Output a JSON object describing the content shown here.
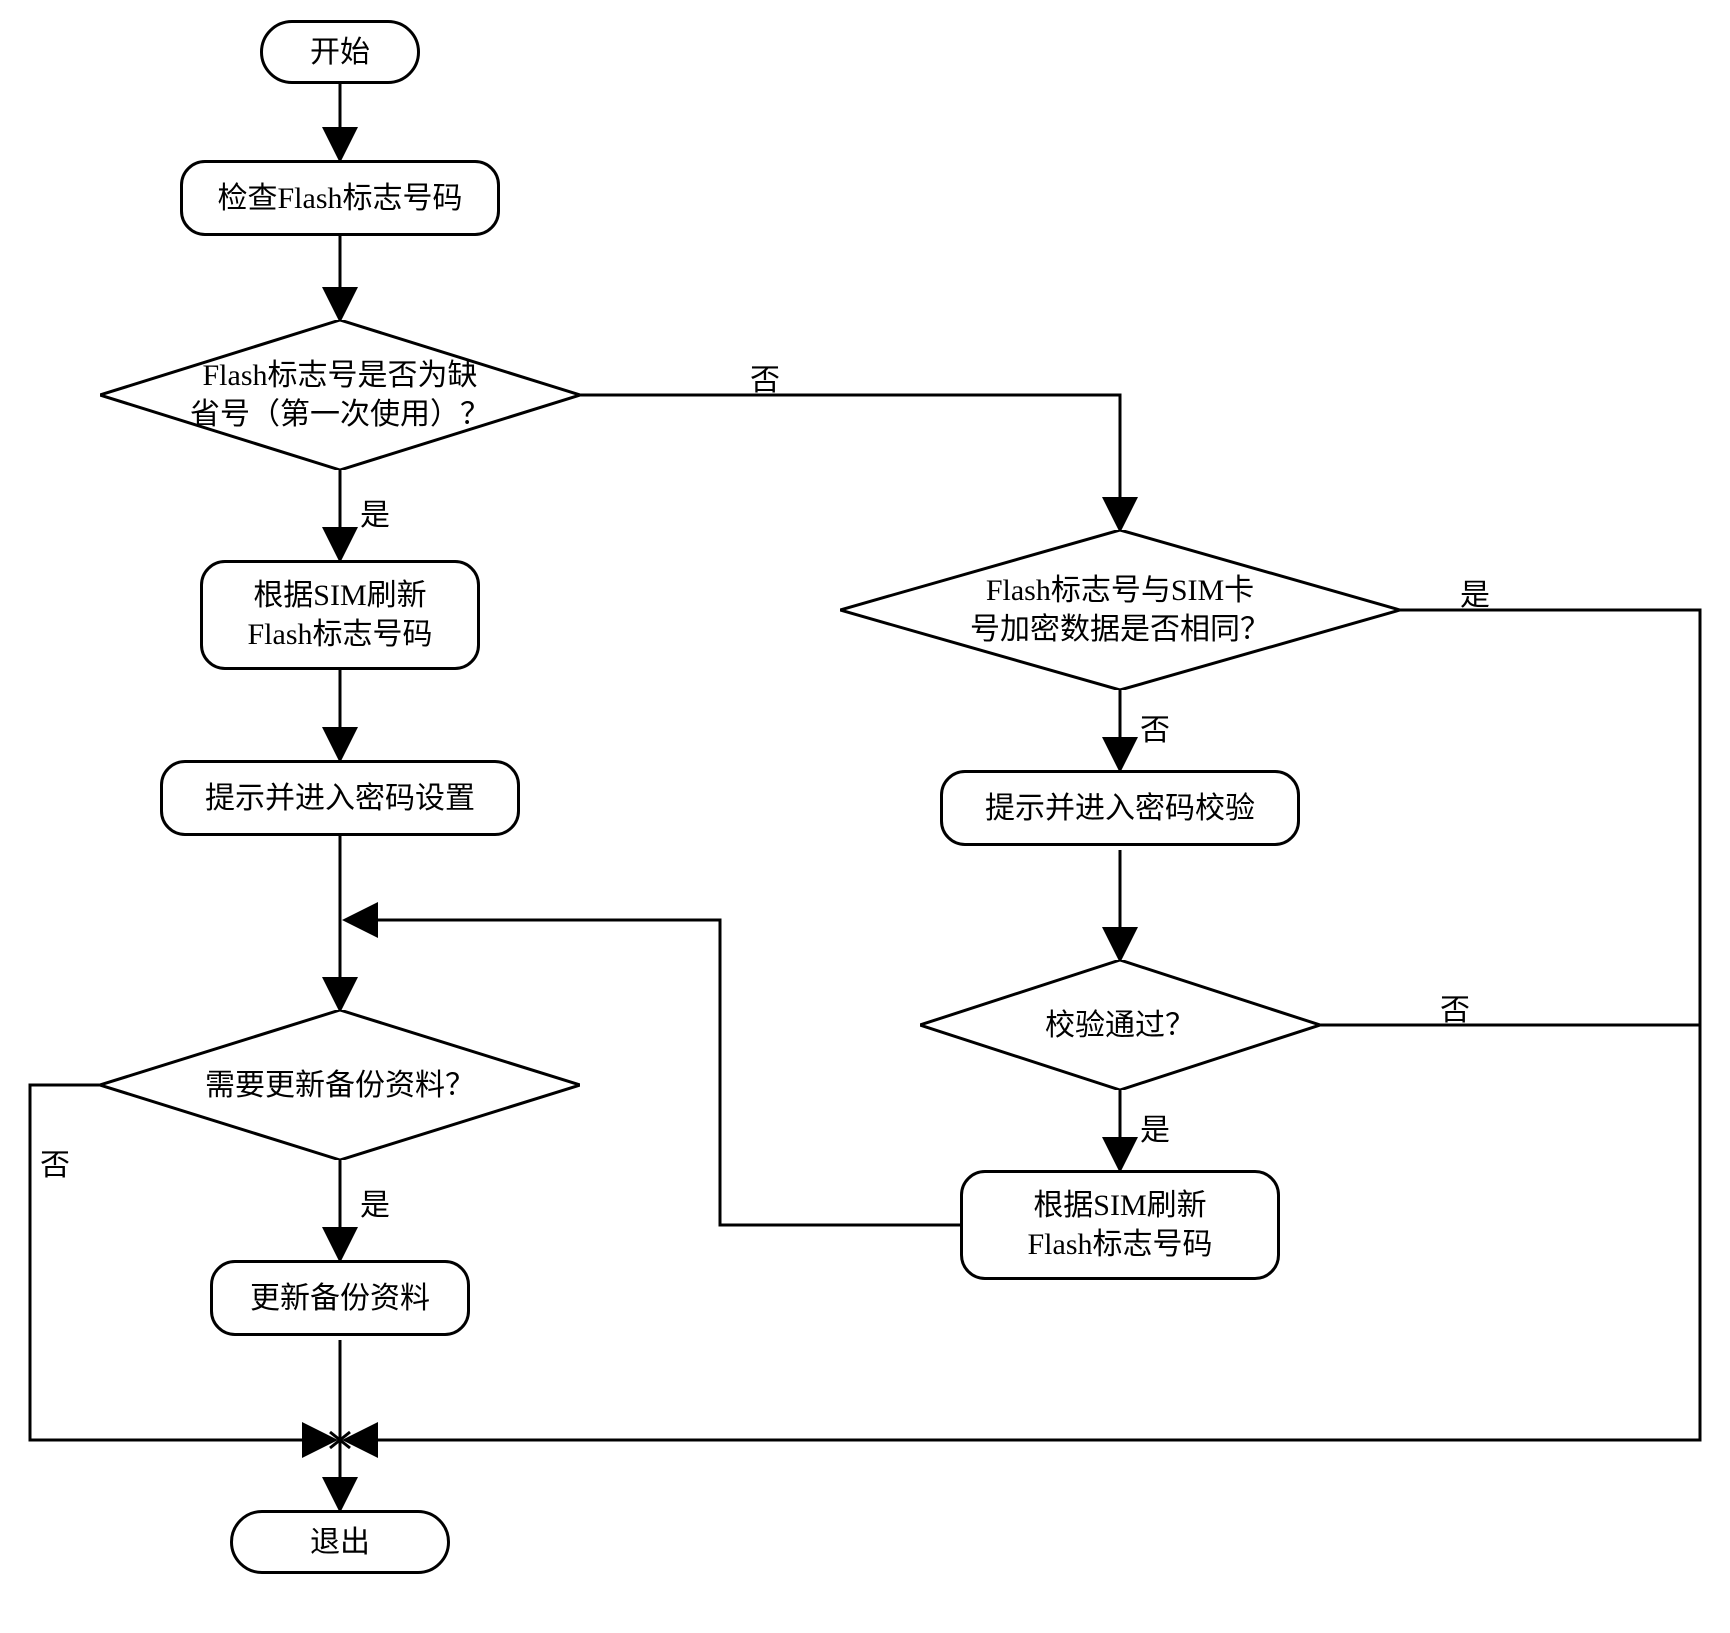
{
  "chart_data": {
    "type": "flowchart",
    "nodes": [
      {
        "id": "start",
        "kind": "terminator",
        "text": "开始"
      },
      {
        "id": "check_flag",
        "kind": "process",
        "text": "检查Flash标志号码"
      },
      {
        "id": "is_default",
        "kind": "decision",
        "text": "Flash标志号是否为缺\n省号（第一次使用）？"
      },
      {
        "id": "refresh_sim1",
        "kind": "process",
        "text": "根据SIM刷新\nFlash标志号码"
      },
      {
        "id": "set_pwd",
        "kind": "process",
        "text": "提示并进入密码设置"
      },
      {
        "id": "need_update",
        "kind": "decision",
        "text": "需要更新备份资料？"
      },
      {
        "id": "update",
        "kind": "process",
        "text": "更新备份资料"
      },
      {
        "id": "exit",
        "kind": "terminator",
        "text": "退出"
      },
      {
        "id": "same_enc",
        "kind": "decision",
        "text": "Flash标志号与SIM卡\n号加密数据是否相同？"
      },
      {
        "id": "verify_pwd",
        "kind": "process",
        "text": "提示并进入密码校验"
      },
      {
        "id": "verify_ok",
        "kind": "decision",
        "text": "校验通过？"
      },
      {
        "id": "refresh_sim2",
        "kind": "process",
        "text": "根据SIM刷新\nFlash标志号码"
      }
    ],
    "edges": [
      {
        "from": "start",
        "to": "check_flag"
      },
      {
        "from": "check_flag",
        "to": "is_default"
      },
      {
        "from": "is_default",
        "to": "refresh_sim1",
        "label": "是"
      },
      {
        "from": "is_default",
        "to": "same_enc",
        "label": "否"
      },
      {
        "from": "refresh_sim1",
        "to": "set_pwd"
      },
      {
        "from": "set_pwd",
        "to": "need_update"
      },
      {
        "from": "need_update",
        "to": "update",
        "label": "是"
      },
      {
        "from": "need_update",
        "to": "exit",
        "label": "否"
      },
      {
        "from": "update",
        "to": "exit"
      },
      {
        "from": "same_enc",
        "to": "verify_pwd",
        "label": "否"
      },
      {
        "from": "same_enc",
        "to": "need_update",
        "label": "是",
        "route": "far-right-down-left"
      },
      {
        "from": "verify_pwd",
        "to": "verify_ok"
      },
      {
        "from": "verify_ok",
        "to": "refresh_sim2",
        "label": "是"
      },
      {
        "from": "verify_ok",
        "to": "need_update",
        "label": "否",
        "route": "far-right-down-left"
      },
      {
        "from": "refresh_sim2",
        "to": "need_update",
        "route": "left-up"
      }
    ]
  },
  "labels": {
    "yes": "是",
    "no": "否"
  },
  "nodes": {
    "start": "开始",
    "check_flag": "检查Flash标志号码",
    "is_default_l1": "Flash标志号是否为缺",
    "is_default_l2": "省号（第一次使用）？",
    "refresh_sim1_l1": "根据SIM刷新",
    "refresh_sim1_l2": "Flash标志号码",
    "set_pwd": "提示并进入密码设置",
    "need_update": "需要更新备份资料？",
    "update": "更新备份资料",
    "exit": "退出",
    "same_enc_l1": "Flash标志号与SIM卡",
    "same_enc_l2": "号加密数据是否相同？",
    "verify_pwd": "提示并进入密码校验",
    "verify_ok": "校验通过？",
    "refresh_sim2_l1": "根据SIM刷新",
    "refresh_sim2_l2": "Flash标志号码"
  }
}
